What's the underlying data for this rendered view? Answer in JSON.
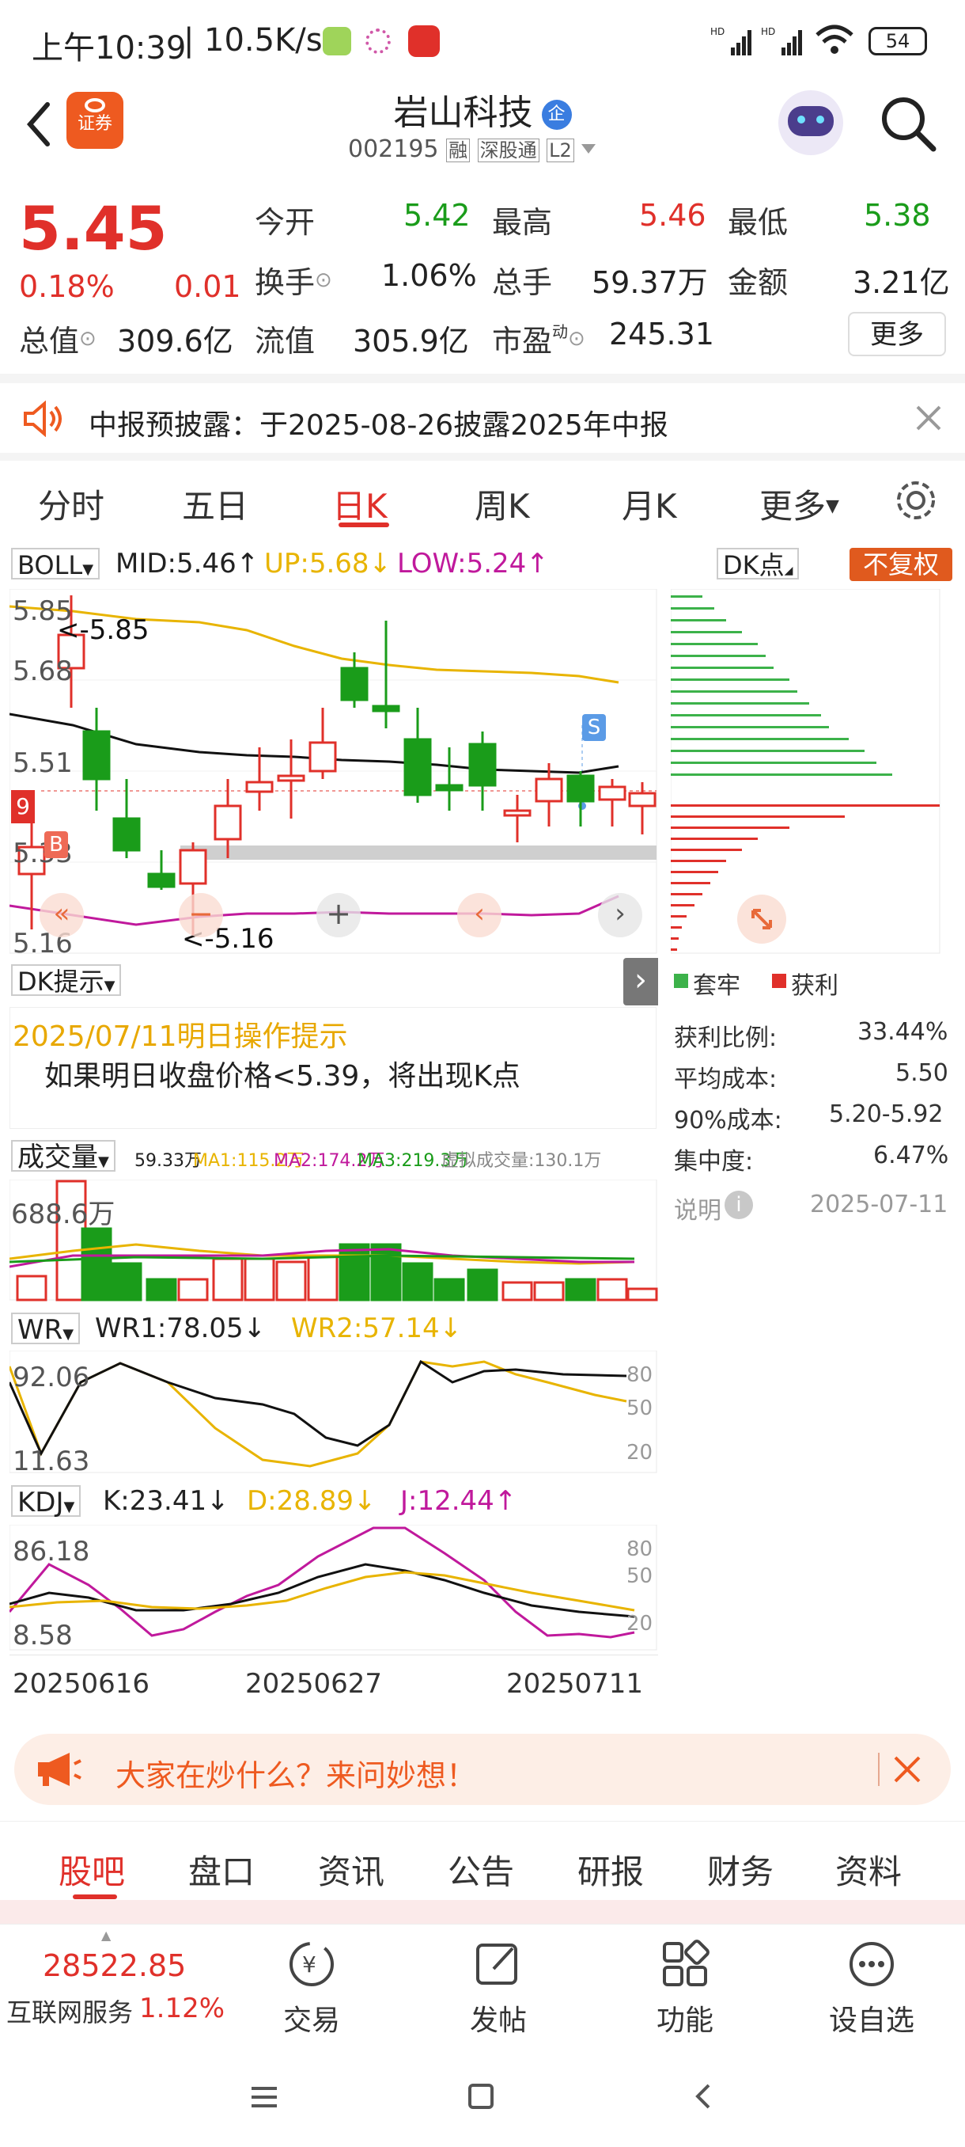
{
  "status_bar": {
    "time": "上午10:39",
    "speed": "10.5K/s",
    "battery": "54"
  },
  "header": {
    "badge_label": "证券",
    "stock_name": "岩山科技",
    "enterprise_badge": "企",
    "code": "002195",
    "tags": [
      "融",
      "深股通",
      "L2"
    ]
  },
  "quote": {
    "price": "5.45",
    "change_pct": "0.18%",
    "change_abs": "0.01",
    "open_label": "今开",
    "open": "5.42",
    "high_label": "最高",
    "high": "5.46",
    "low_label": "最低",
    "low": "5.38",
    "turnover_label": "换手",
    "turnover": "1.06%",
    "volume_label": "总手",
    "volume": "59.37万",
    "amount_label": "金额",
    "amount": "3.21亿",
    "mktcap_label": "总值",
    "mktcap": "309.6亿",
    "float_label": "流值",
    "float_cap": "305.9亿",
    "pe_label": "市盈",
    "pe_sup": "动",
    "pe": "245.31",
    "more_label": "更多"
  },
  "notice": {
    "text": "中报预披露：于2025-08-26披露2025年中报"
  },
  "chart_tabs": [
    "分时",
    "五日",
    "日K",
    "周K",
    "月K",
    "更多"
  ],
  "kline": {
    "indicator_name": "BOLL",
    "mid": "MID:5.46",
    "up": "UP:5.68",
    "low": "LOW:5.24",
    "dk_button": "DK点",
    "adjust_button": "不复权",
    "y_labels": [
      "5.85",
      "5.68",
      "5.51",
      "5.33",
      "5.16"
    ],
    "hi_marker": "<-5.85",
    "lo_marker": "<-5.16",
    "price_tag": "9",
    "buy_marker": "B",
    "sell_marker": "S"
  },
  "chip_panel": {
    "legend_trapped": "套牢",
    "legend_profit": "获利",
    "stats": [
      {
        "label": "获利比例:",
        "value": "33.44%"
      },
      {
        "label": "平均成本:",
        "value": "5.50"
      },
      {
        "label": "90%成本:",
        "value": "5.20-5.92"
      },
      {
        "label": "集中度:",
        "value": "6.47%"
      }
    ],
    "note_label": "说明",
    "note_date": "2025-07-11"
  },
  "dk_hint": {
    "button": "DK提示",
    "date_title": "2025/07/11明日操作提示",
    "text": "如果明日收盘价格<5.39，将出现K点"
  },
  "volume": {
    "name": "成交量",
    "vol": "59.33万",
    "ma1": "MA1:115.2万",
    "ma2": "MA2:174.2万",
    "ma3": "MA3:219.3万",
    "virtual": "虚拟成交量:130.1万",
    "max_label": "688.6万"
  },
  "wr": {
    "name": "WR",
    "wr1": "WR1:78.05",
    "wr2": "WR2:57.14",
    "top_label": "92.06",
    "bottom_label": "11.63",
    "right_labels": [
      "80",
      "50",
      "20"
    ]
  },
  "kdj": {
    "name": "KDJ",
    "k": "K:23.41",
    "d": "D:28.89",
    "j": "J:12.44",
    "top_label": "86.18",
    "bottom_label": "8.58",
    "right_labels": [
      "80",
      "50",
      "20"
    ]
  },
  "dates": [
    "20250616",
    "20250627",
    "20250711"
  ],
  "promo": {
    "text": "大家在炒什么？来问妙想！"
  },
  "bottom_tabs": [
    "股吧",
    "盘口",
    "资讯",
    "公告",
    "研报",
    "财务",
    "资料"
  ],
  "nav": {
    "index_value": "28522.85",
    "index_name": "互联网服务",
    "index_change": "1.12%",
    "items": [
      "交易",
      "发帖",
      "功能",
      "设自选"
    ]
  },
  "colors": {
    "up": "#e0302a",
    "down": "#1a9c1a",
    "mid": "#111111",
    "upper": "#e8b400",
    "lower": "#c0199c"
  }
}
